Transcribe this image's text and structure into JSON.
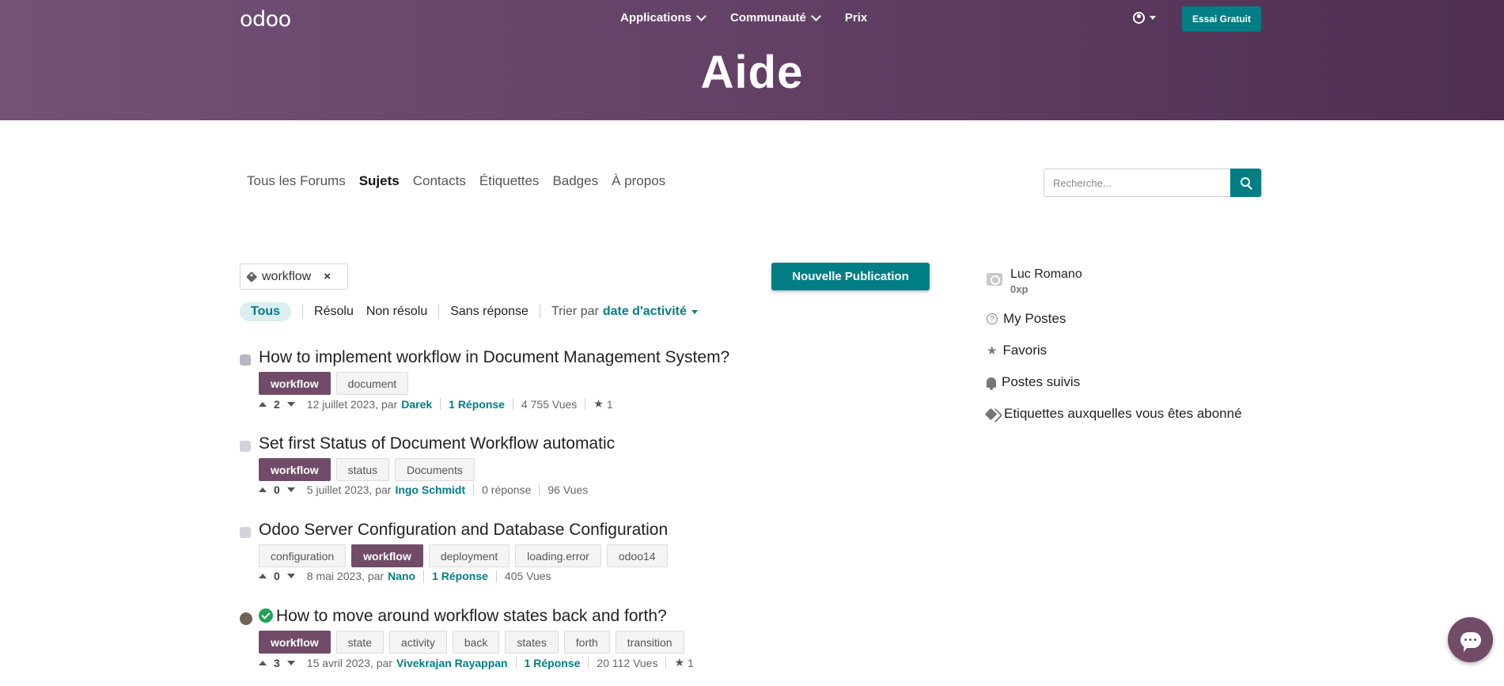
{
  "header": {
    "logo": "odoo",
    "nav": [
      {
        "label": "Applications"
      },
      {
        "label": "Communauté"
      },
      {
        "label": "Prix"
      }
    ],
    "trial_label": "Essai Gratuit",
    "page_title": "Aide"
  },
  "subnav": {
    "items": [
      {
        "label": "Tous les Forums"
      },
      {
        "label": "Sujets"
      },
      {
        "label": "Contacts"
      },
      {
        "label": "Étiquettes"
      },
      {
        "label": "Badges"
      },
      {
        "label": "À propos"
      }
    ],
    "search_placeholder": "Recherche..."
  },
  "filter_bar": {
    "active_tag": "workflow",
    "remove_symbol": "×",
    "new_post_label": "Nouvelle Publication",
    "filters": [
      "Tous",
      "Résolu",
      "Non résolu",
      "Sans réponse"
    ],
    "sort_label": "Trier par",
    "sort_value": "date d'activité"
  },
  "posts": [
    {
      "title": "How to implement workflow in Document Management System?",
      "tags": [
        "workflow",
        "document"
      ],
      "votes": "2",
      "date": "12 juillet 2023, par",
      "author": "Darek",
      "answers": "1 Réponse",
      "views": "4 755 Vues",
      "favorites": "1"
    },
    {
      "title": "Set first Status of Document Workflow automatic",
      "tags": [
        "workflow",
        "status",
        "Documents"
      ],
      "votes": "0",
      "date": "5 juillet 2023, par",
      "author": "Ingo Schmidt",
      "answers": "0 réponse",
      "views": "96 Vues"
    },
    {
      "title": "Odoo Server Configuration and Database Configuration",
      "tags": [
        "configuration",
        "workflow",
        "deployment",
        "loading.error",
        "odoo14"
      ],
      "votes": "0",
      "date": "8 mai 2023, par",
      "author": "Nano",
      "answers": "1 Réponse",
      "views": "405 Vues"
    },
    {
      "title": "How to move around workflow states back and forth?",
      "tags": [
        "workflow",
        "state",
        "activity",
        "back",
        "states",
        "forth",
        "transition"
      ],
      "votes": "3",
      "date": "15 avril 2023, par",
      "author": "Vivekrajan Rayappan",
      "answers": "1 Réponse",
      "views": "20 112 Vues",
      "favorites": "1"
    }
  ],
  "sidebar": {
    "user_name": "Luc Romano",
    "user_xp": "0xp",
    "links": [
      "My Postes",
      "Favoris",
      "Postes suivis",
      "Etiquettes auxquelles vous êtes abonné"
    ]
  },
  "colors": {
    "brand_purple": "#714b67",
    "accent_teal": "#017e84"
  }
}
